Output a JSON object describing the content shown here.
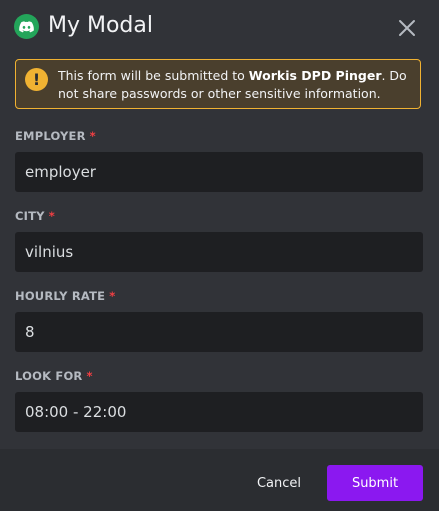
{
  "header": {
    "title": "My Modal"
  },
  "notice": {
    "prefix": "This form will be submitted to ",
    "app_name": "Workis DPD Pinger",
    "suffix": ". Do not share passwords or other sensitive information."
  },
  "fields": [
    {
      "label": "EMPLOYER",
      "required": "*",
      "value": "employer"
    },
    {
      "label": "CITY",
      "required": "*",
      "value": "vilnius"
    },
    {
      "label": "HOURLY RATE",
      "required": "*",
      "value": "8"
    },
    {
      "label": "LOOK FOR",
      "required": "*",
      "value": "08:00 - 22:00"
    }
  ],
  "footer": {
    "cancel_label": "Cancel",
    "submit_label": "Submit"
  },
  "colors": {
    "background": "#313338",
    "footer": "#2b2d31",
    "input": "#1e1f22",
    "accent": "#8b18f0",
    "warning": "#f0b232",
    "required": "#f23f43",
    "app_icon": "#23a55a"
  },
  "icons": {
    "app": "discord-logo-icon",
    "close": "close-icon",
    "warning": "exclamation-icon"
  }
}
